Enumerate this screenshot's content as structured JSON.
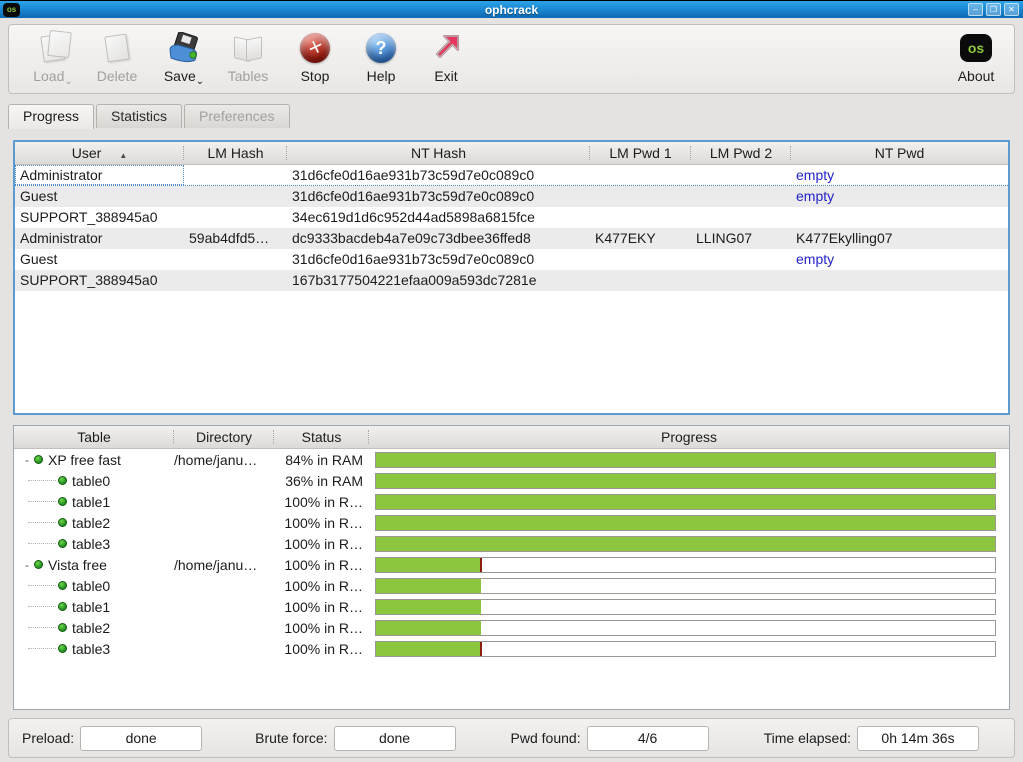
{
  "window": {
    "title": "ophcrack",
    "logo_text": "os",
    "controls": {
      "minimize": "–",
      "maximize": "❐",
      "close": "✕"
    }
  },
  "toolbar": {
    "buttons": [
      {
        "id": "load",
        "label": "Load",
        "enabled": false,
        "dropdown": true
      },
      {
        "id": "delete",
        "label": "Delete",
        "enabled": false,
        "dropdown": false
      },
      {
        "id": "save",
        "label": "Save",
        "enabled": true,
        "dropdown": true
      },
      {
        "id": "tables",
        "label": "Tables",
        "enabled": false,
        "dropdown": false
      },
      {
        "id": "stop",
        "label": "Stop",
        "enabled": true,
        "dropdown": false
      },
      {
        "id": "help",
        "label": "Help",
        "enabled": true,
        "dropdown": false
      },
      {
        "id": "exit",
        "label": "Exit",
        "enabled": true,
        "dropdown": false
      }
    ],
    "about_label": "About",
    "about_logo": "os",
    "help_glyph": "?",
    "dropdown_glyph": "⌄"
  },
  "tabs": [
    {
      "label": "Progress",
      "state": "active"
    },
    {
      "label": "Statistics",
      "state": "normal"
    },
    {
      "label": "Preferences",
      "state": "disabled"
    }
  ],
  "hash_table": {
    "columns": [
      "User",
      "LM Hash",
      "NT Hash",
      "LM Pwd 1",
      "LM Pwd 2",
      "NT Pwd"
    ],
    "sort": {
      "column": "User",
      "direction": "asc",
      "glyph": "▲"
    },
    "rows": [
      {
        "user": "Administrator",
        "lm_hash": "",
        "nt_hash": "31d6cfe0d16ae931b73c59d7e0c089c0",
        "lm_pwd1": "",
        "lm_pwd2": "",
        "nt_pwd": "empty",
        "nt_pwd_is_empty": true,
        "selected": true
      },
      {
        "user": "Guest",
        "lm_hash": "",
        "nt_hash": "31d6cfe0d16ae931b73c59d7e0c089c0",
        "lm_pwd1": "",
        "lm_pwd2": "",
        "nt_pwd": "empty",
        "nt_pwd_is_empty": true,
        "selected": false
      },
      {
        "user": "SUPPORT_388945a0",
        "lm_hash": "",
        "nt_hash": "34ec619d1d6c952d44ad5898a6815fce",
        "lm_pwd1": "",
        "lm_pwd2": "",
        "nt_pwd": "",
        "nt_pwd_is_empty": false,
        "selected": false
      },
      {
        "user": "Administrator",
        "lm_hash": "59ab4dfd5…",
        "nt_hash": "dc9333bacdeb4a7e09c73dbee36ffed8",
        "lm_pwd1": "K477EKY",
        "lm_pwd2": "LLING07",
        "nt_pwd": "K477Ekylling07",
        "nt_pwd_is_empty": false,
        "selected": false
      },
      {
        "user": "Guest",
        "lm_hash": "",
        "nt_hash": "31d6cfe0d16ae931b73c59d7e0c089c0",
        "lm_pwd1": "",
        "lm_pwd2": "",
        "nt_pwd": "empty",
        "nt_pwd_is_empty": true,
        "selected": false
      },
      {
        "user": "SUPPORT_388945a0",
        "lm_hash": "",
        "nt_hash": "167b3177504221efaa009a593dc7281e",
        "lm_pwd1": "",
        "lm_pwd2": "",
        "nt_pwd": "",
        "nt_pwd_is_empty": false,
        "selected": false
      }
    ]
  },
  "tables_panel": {
    "columns": [
      "Table",
      "Directory",
      "Status",
      "Progress"
    ],
    "expander_glyph": "-",
    "rows": [
      {
        "name": "XP free fast",
        "level": 0,
        "directory": "/home/janu…",
        "status": "84% in RAM",
        "progress_pct": 100,
        "marker": false
      },
      {
        "name": "table0",
        "level": 1,
        "directory": "",
        "status": "36% in RAM",
        "progress_pct": 100,
        "marker": false
      },
      {
        "name": "table1",
        "level": 1,
        "directory": "",
        "status": "100% in R…",
        "progress_pct": 100,
        "marker": false
      },
      {
        "name": "table2",
        "level": 1,
        "directory": "",
        "status": "100% in R…",
        "progress_pct": 100,
        "marker": false
      },
      {
        "name": "table3",
        "level": 1,
        "directory": "",
        "status": "100% in R…",
        "progress_pct": 100,
        "marker": false
      },
      {
        "name": "Vista free",
        "level": 0,
        "directory": "/home/janu…",
        "status": "100% in R…",
        "progress_pct": 17,
        "marker": true
      },
      {
        "name": "table0",
        "level": 1,
        "directory": "",
        "status": "100% in R…",
        "progress_pct": 17,
        "marker": false
      },
      {
        "name": "table1",
        "level": 1,
        "directory": "",
        "status": "100% in R…",
        "progress_pct": 17,
        "marker": false
      },
      {
        "name": "table2",
        "level": 1,
        "directory": "",
        "status": "100% in R…",
        "progress_pct": 17,
        "marker": false
      },
      {
        "name": "table3",
        "level": 1,
        "directory": "",
        "status": "100% in R…",
        "progress_pct": 17,
        "marker": true
      }
    ]
  },
  "status_bar": {
    "fields": [
      {
        "label": "Preload:",
        "value": "done"
      },
      {
        "label": "Brute force:",
        "value": "done"
      },
      {
        "label": "Pwd found:",
        "value": "4/6"
      },
      {
        "label": "Time elapsed:",
        "value": "0h 14m 36s"
      }
    ]
  },
  "colors": {
    "progress_green": "#8cc63e",
    "marker_red": "#8c1d10",
    "link_blue": "#2323cd",
    "titlebar_top": "#2da3e8",
    "titlebar_bottom": "#0d68b2",
    "focus_border_blue": "#5c9bd1",
    "logo_green": "#8dc63f"
  }
}
